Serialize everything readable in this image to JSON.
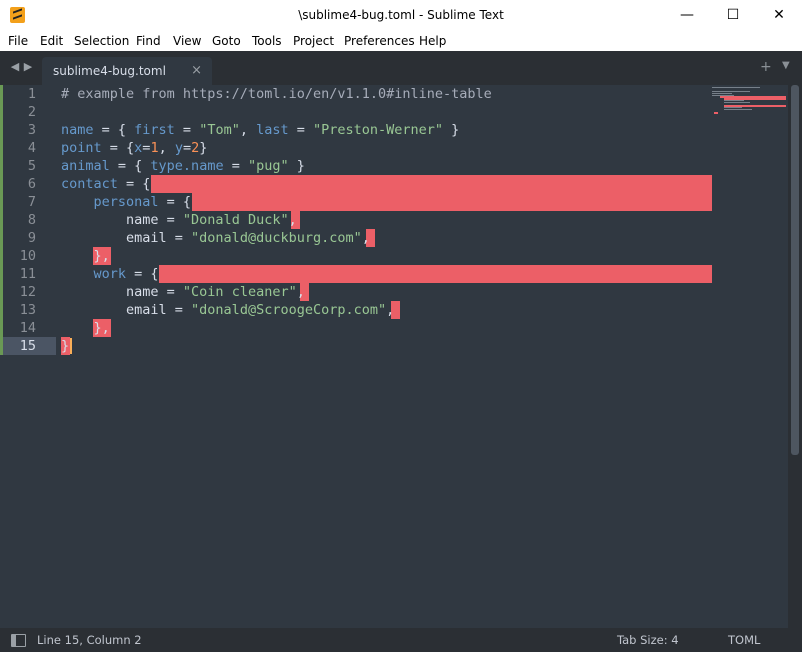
{
  "window": {
    "title": "\\sublime4-bug.toml - Sublime Text",
    "minimize": "—",
    "maximize": "☐",
    "close": "✕"
  },
  "menu": [
    "File",
    "Edit",
    "Selection",
    "Find",
    "View",
    "Goto",
    "Tools",
    "Project",
    "Preferences",
    "Help"
  ],
  "tabs": [
    {
      "label": "sublime4-bug.toml",
      "close": "×"
    }
  ],
  "tabbar": {
    "prev": "◀",
    "next": "▶",
    "plus": "+",
    "dropdown": "▼"
  },
  "editor": {
    "active_line": 15,
    "lines": [
      [
        {
          "t": "# example from https://toml.io/en/v1.1.0#inline-table",
          "c": "com"
        }
      ],
      [],
      [
        {
          "t": "name",
          "c": "key"
        },
        {
          "t": " = { "
        },
        {
          "t": "first",
          "c": "key"
        },
        {
          "t": " = "
        },
        {
          "t": "\"Tom\"",
          "c": "str"
        },
        {
          "t": ", "
        },
        {
          "t": "last",
          "c": "key"
        },
        {
          "t": " = "
        },
        {
          "t": "\"Preston-Werner\"",
          "c": "str"
        },
        {
          "t": " }"
        }
      ],
      [
        {
          "t": "point",
          "c": "key"
        },
        {
          "t": " = {"
        },
        {
          "t": "x",
          "c": "key"
        },
        {
          "t": "="
        },
        {
          "t": "1",
          "c": "num"
        },
        {
          "t": ", "
        },
        {
          "t": "y",
          "c": "key"
        },
        {
          "t": "="
        },
        {
          "t": "2",
          "c": "num"
        },
        {
          "t": "}"
        }
      ],
      [
        {
          "t": "animal",
          "c": "key"
        },
        {
          "t": " = { "
        },
        {
          "t": "type.name",
          "c": "key"
        },
        {
          "t": " = "
        },
        {
          "t": "\"pug\"",
          "c": "str"
        },
        {
          "t": " }"
        }
      ],
      [
        {
          "t": "contact",
          "c": "key"
        },
        {
          "t": " = {"
        }
      ],
      [
        {
          "t": "    "
        },
        {
          "t": "personal",
          "c": "key"
        },
        {
          "t": " = {"
        }
      ],
      [
        {
          "t": "        name = "
        },
        {
          "t": "\"Donald Duck\"",
          "c": "str"
        },
        {
          "t": ","
        }
      ],
      [
        {
          "t": "        email = "
        },
        {
          "t": "\"donald@duckburg.com\"",
          "c": "str"
        },
        {
          "t": ","
        }
      ],
      [
        {
          "t": "    },"
        }
      ],
      [
        {
          "t": "    "
        },
        {
          "t": "work",
          "c": "key"
        },
        {
          "t": " = {"
        }
      ],
      [
        {
          "t": "        name = "
        },
        {
          "t": "\"Coin cleaner\"",
          "c": "str"
        },
        {
          "t": ","
        }
      ],
      [
        {
          "t": "        email = "
        },
        {
          "t": "\"donald@ScroogeCorp.com\"",
          "c": "str"
        },
        {
          "t": ","
        }
      ],
      [
        {
          "t": "    },"
        }
      ],
      [
        {
          "t": "}"
        }
      ]
    ]
  },
  "status": {
    "position": "Line 15, Column 2",
    "tab_size": "Tab Size: 4",
    "syntax": "TOML"
  },
  "colors": {
    "editor_bg": "#303841",
    "chrome_bg": "#2b2f34",
    "error_highlight": "#ec5f67",
    "caret": "#f9ae58",
    "modified_bar": "#6a9955"
  }
}
